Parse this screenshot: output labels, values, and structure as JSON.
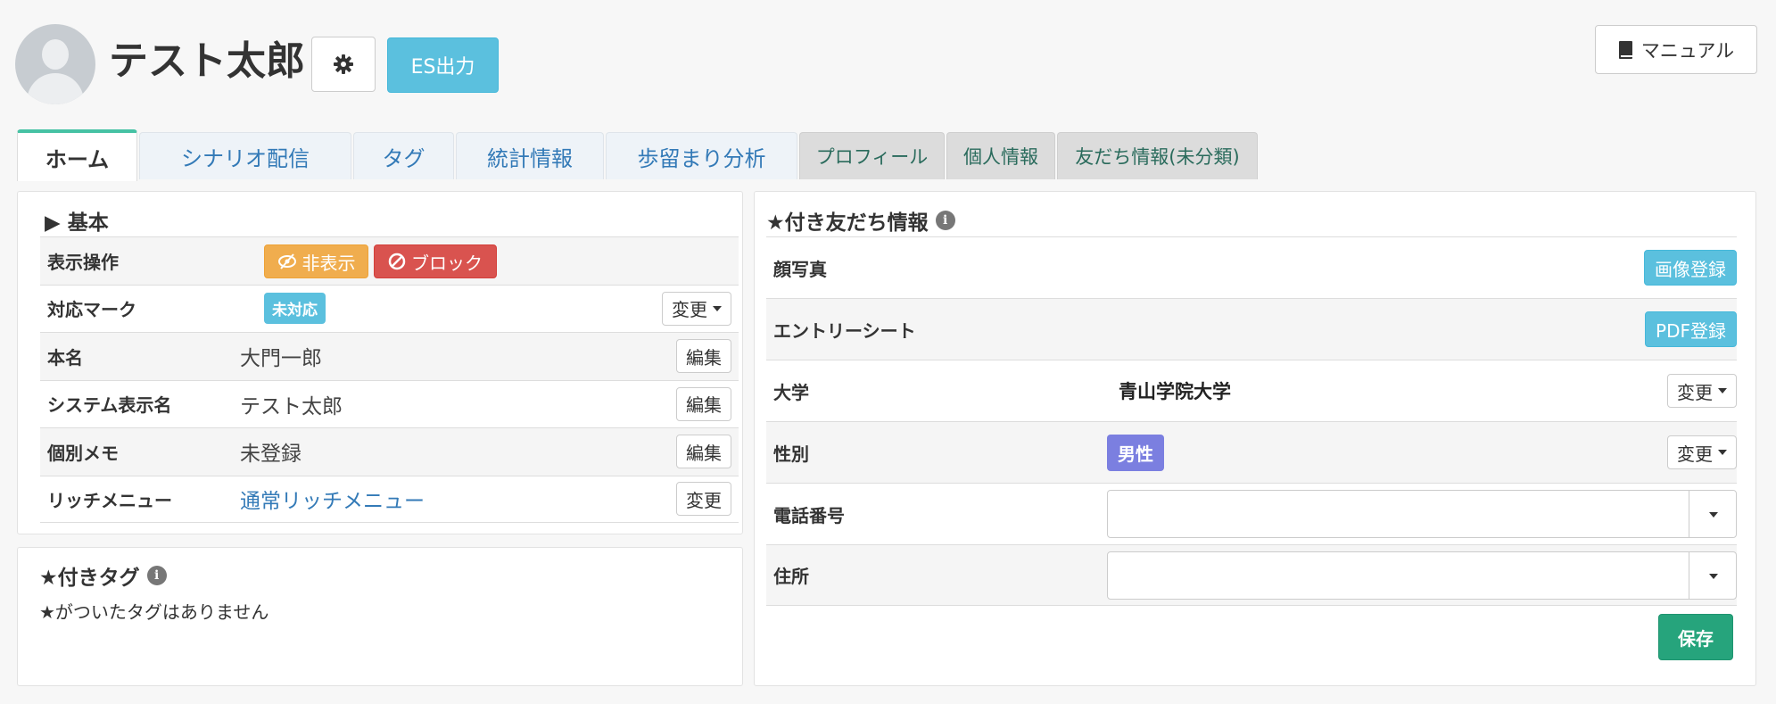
{
  "header": {
    "user_name": "テスト太郎",
    "es_button": "ES出力",
    "manual_button": "マニュアル",
    "icons": {
      "avatar": "user-silhouette",
      "settings": "gear-icon",
      "manual": "book-icon"
    }
  },
  "tabs": [
    {
      "label": "ホーム",
      "active": true
    },
    {
      "label": "シナリオ配信"
    },
    {
      "label": "タグ"
    },
    {
      "label": "統計情報"
    },
    {
      "label": "歩留まり分析"
    },
    {
      "label": "プロフィール"
    },
    {
      "label": "個人情報"
    },
    {
      "label": "友だち情報(未分類)"
    }
  ],
  "basic": {
    "title": "▶ 基本",
    "rows": {
      "display_ops": {
        "label": "表示操作",
        "hide_button": "非表示",
        "block_button": "ブロック"
      },
      "mark": {
        "label": "対応マーク",
        "badge": "未対応",
        "button": "変更"
      },
      "real_name": {
        "label": "本名",
        "value": "大門一郎",
        "button": "編集"
      },
      "system_name": {
        "label": "システム表示名",
        "value": "テスト太郎",
        "button": "編集"
      },
      "memo": {
        "label": "個別メモ",
        "value": "未登録",
        "button": "編集"
      },
      "rich_menu": {
        "label": "リッチメニュー",
        "value": "通常リッチメニュー",
        "button": "変更"
      }
    }
  },
  "starred_tags": {
    "title": "★付きタグ",
    "empty_message": "★がついたタグはありません"
  },
  "friend_info": {
    "title": "★付き友だち情報",
    "rows": {
      "photo": {
        "label": "顔写真",
        "button": "画像登録"
      },
      "entry_sheet": {
        "label": "エントリーシート",
        "button": "PDF登録"
      },
      "university": {
        "label": "大学",
        "value": "青山学院大学",
        "button": "変更"
      },
      "gender": {
        "label": "性別",
        "badge": "男性",
        "button": "変更"
      },
      "phone": {
        "label": "電話番号",
        "value": ""
      },
      "address": {
        "label": "住所",
        "value": ""
      }
    },
    "save_button": "保存"
  },
  "colors": {
    "info": "#5bc0de",
    "warning": "#f0ad4e",
    "danger": "#d9534f",
    "success": "#26a47c",
    "purple_badge": "#7b7fe0",
    "active_tab_accent": "#46c2a4",
    "link": "#337ab7"
  }
}
